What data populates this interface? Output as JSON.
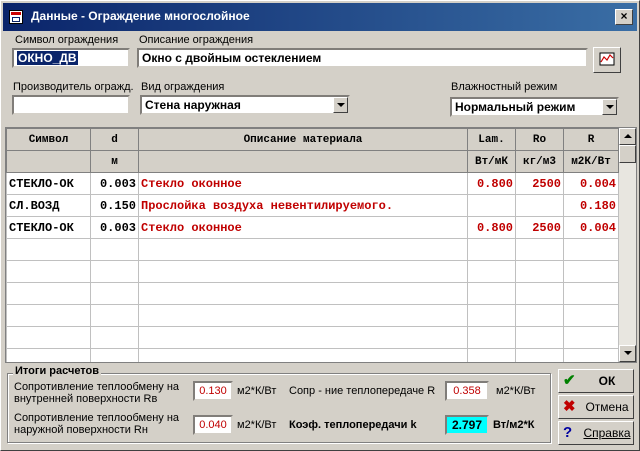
{
  "window": {
    "title": "Данные - Ограждение многослойное",
    "close": "×"
  },
  "form": {
    "symbol_label": "Символ ограждения",
    "symbol_value": "ОКНО_ДВ",
    "description_label": "Описание ограждения",
    "description_value": "Окно с двойным остеклением",
    "manufacturer_label": "Производитель огражд.",
    "manufacturer_value": "",
    "type_label": "Вид ограждения",
    "type_value": "Стена наружная",
    "humidity_label": "Влажностный режим",
    "humidity_value": "Нормальный режим"
  },
  "table": {
    "headers": [
      "Символ",
      "d",
      "Описание материала",
      "Lam.",
      "Ro",
      "R"
    ],
    "units": [
      "",
      "м",
      "",
      "Вт/мК",
      "кг/м3",
      "м2К/Вт"
    ],
    "rows": [
      [
        "СТЕКЛО-ОК",
        "0.003",
        "Стекло оконное",
        "0.800",
        "2500",
        "0.004"
      ],
      [
        "СЛ.ВОЗД",
        "0.150",
        "Прослойка воздуха невентилируемого.",
        "",
        "",
        "0.180"
      ],
      [
        "СТЕКЛО-ОК",
        "0.003",
        "Стекло оконное",
        "0.800",
        "2500",
        "0.004"
      ]
    ]
  },
  "results": {
    "title": "Итоги расчетов",
    "rin_label": "Сопротивление теплообмену на внутренней поверхности Rв",
    "rin_value": "0.130",
    "rin_unit": "м2*К/Вт",
    "rout_label": "Сопротивление теплообмену на наружной поверхности Rн",
    "rout_value": "0.040",
    "rout_unit": "м2*К/Вт",
    "r_label": "Сопр - ние теплопередаче R",
    "r_value": "0.358",
    "r_unit": "м2*К/Вт",
    "k_label": "Коэф. теплопередачи k",
    "k_value": "2.797",
    "k_unit": "Вт/м2*К"
  },
  "buttons": {
    "ok": "ОК",
    "cancel": "Отмена",
    "help": "Справка"
  },
  "icons": {
    "ok": "check-icon",
    "cancel": "x-icon",
    "help": "question-icon",
    "graph": "chart-icon"
  }
}
